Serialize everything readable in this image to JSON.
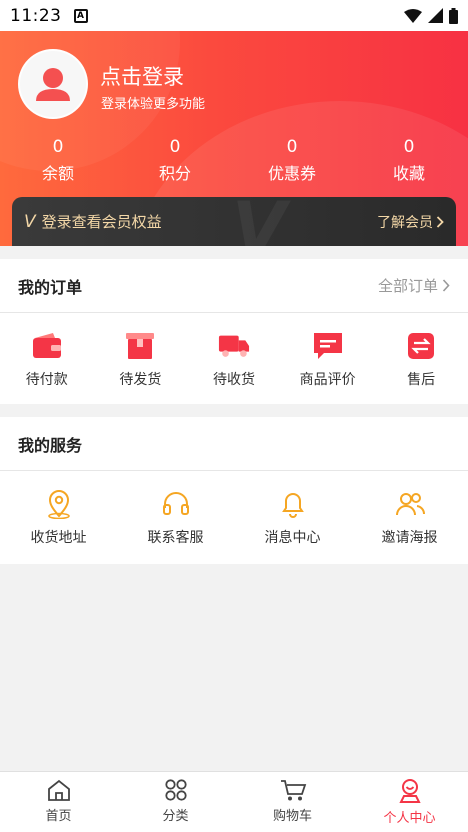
{
  "status_bar": {
    "time": "11:23",
    "notification_badge": "A"
  },
  "profile": {
    "login_title": "点击登录",
    "login_subtitle": "登录体验更多功能",
    "stats": [
      {
        "value": "0",
        "label": "余额"
      },
      {
        "value": "0",
        "label": "积分"
      },
      {
        "value": "0",
        "label": "优惠券"
      },
      {
        "value": "0",
        "label": "收藏"
      }
    ],
    "member_bar": {
      "icon_text": "V",
      "text": "登录查看会员权益",
      "link": "了解会员"
    }
  },
  "orders": {
    "title": "我的订单",
    "all_link": "全部订单",
    "items": [
      {
        "label": "待付款",
        "icon": "wallet-icon"
      },
      {
        "label": "待发货",
        "icon": "box-icon"
      },
      {
        "label": "待收货",
        "icon": "truck-icon"
      },
      {
        "label": "商品评价",
        "icon": "comment-icon"
      },
      {
        "label": "售后",
        "icon": "exchange-icon"
      }
    ]
  },
  "services": {
    "title": "我的服务",
    "items": [
      {
        "label": "收货地址",
        "icon": "location-icon"
      },
      {
        "label": "联系客服",
        "icon": "headset-icon"
      },
      {
        "label": "消息中心",
        "icon": "bell-icon"
      },
      {
        "label": "邀请海报",
        "icon": "users-icon"
      }
    ]
  },
  "tabbar": {
    "items": [
      {
        "label": "首页",
        "icon": "home-icon"
      },
      {
        "label": "分类",
        "icon": "grid-icon"
      },
      {
        "label": "购物车",
        "icon": "cart-icon"
      },
      {
        "label": "个人中心",
        "icon": "person-icon"
      }
    ],
    "active_index": 3
  },
  "colors": {
    "accent": "#f43546",
    "service_icon": "#f5a623",
    "member_text": "#f3d7a7"
  }
}
